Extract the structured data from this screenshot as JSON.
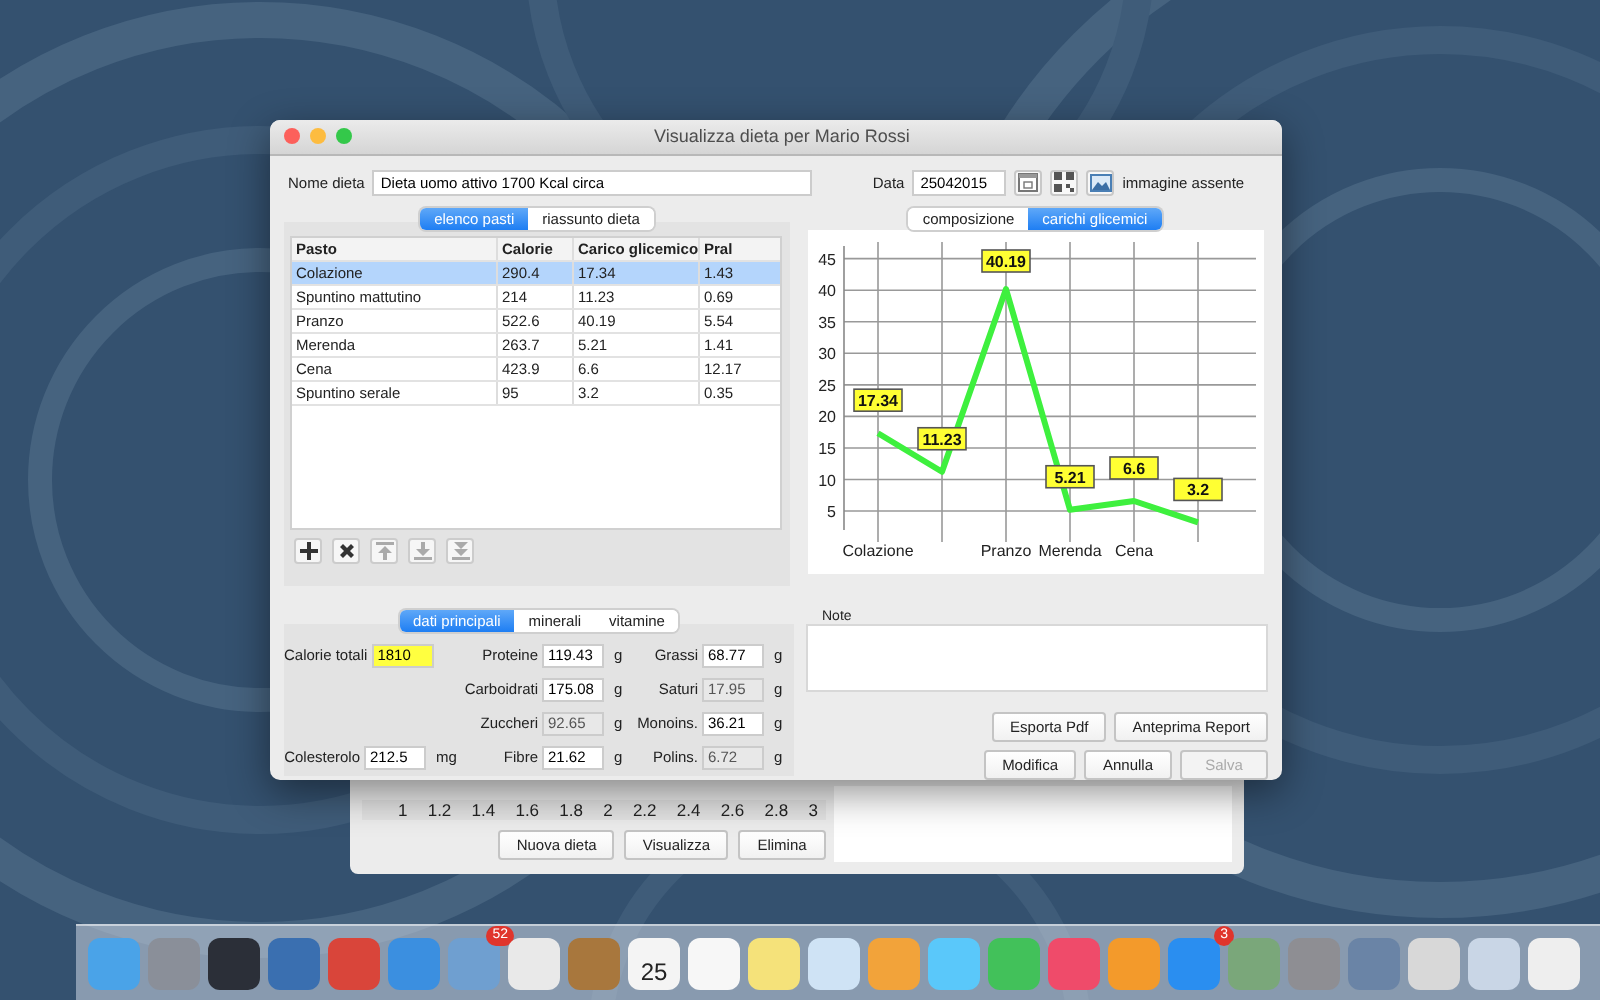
{
  "window": {
    "title": "Visualizza dieta per Mario Rossi",
    "diet_name": {
      "label": "Nome dieta",
      "value": "Dieta uomo attivo 1700 Kcal circa"
    },
    "date": {
      "label": "Data",
      "value": "25042015"
    },
    "image_status": "immagine assente",
    "meal_tabs": [
      {
        "label": "elenco pasti",
        "selected": true
      },
      {
        "label": "riassunto dieta",
        "selected": false
      }
    ],
    "table": {
      "columns": [
        "Pasto",
        "Calorie",
        "Carico glicemico",
        "Pral"
      ],
      "rows": [
        {
          "cells": [
            "Colazione",
            "290.4",
            "17.34",
            "1.43"
          ],
          "selected": true
        },
        {
          "cells": [
            "Spuntino mattutino",
            "214",
            "11.23",
            "0.69"
          ],
          "selected": false
        },
        {
          "cells": [
            "Pranzo",
            "522.6",
            "40.19",
            "5.54"
          ],
          "selected": false
        },
        {
          "cells": [
            "Merenda",
            "263.7",
            "5.21",
            "1.41"
          ],
          "selected": false
        },
        {
          "cells": [
            "Cena",
            "423.9",
            "6.6",
            "12.17"
          ],
          "selected": false
        },
        {
          "cells": [
            "Spuntino serale",
            "95",
            "3.2",
            "0.35"
          ],
          "selected": false
        }
      ]
    },
    "table_tools": [
      {
        "kind": "add",
        "disabled": false
      },
      {
        "kind": "remove",
        "disabled": false
      },
      {
        "kind": "top",
        "disabled": true
      },
      {
        "kind": "down",
        "disabled": true
      },
      {
        "kind": "bottom",
        "disabled": true
      }
    ],
    "chart_tabs": [
      {
        "label": "composizione",
        "selected": false
      },
      {
        "label": "carichi glicemici",
        "selected": true
      }
    ],
    "chart_data": {
      "type": "line",
      "categories": [
        "Colazione",
        null,
        "Pranzo",
        "Merenda",
        "Cena",
        null
      ],
      "series": [
        {
          "color": "#3ef03e",
          "values": [
            17.34,
            11.23,
            40.19,
            5.21,
            6.6,
            3.2
          ]
        }
      ],
      "yticks": [
        5,
        10,
        15,
        20,
        25,
        30,
        35,
        40,
        45
      ],
      "ylim": [
        2,
        47
      ],
      "grid": true,
      "data_labels": true
    },
    "nutrient_tabs": [
      {
        "label": "dati principali",
        "selected": true
      },
      {
        "label": "minerali",
        "selected": false
      },
      {
        "label": "vitamine",
        "selected": false
      }
    ],
    "nutrients": [
      [
        {
          "label": "Calorie totali",
          "value": "1810",
          "highlighted": true,
          "disabled": false
        },
        {
          "label": "Proteine",
          "value": "119.43",
          "unit": "g",
          "highlighted": false,
          "disabled": false
        },
        {
          "label": "Grassi",
          "value": "68.77",
          "unit": "g",
          "highlighted": false,
          "disabled": false
        }
      ],
      [
        {
          "label": "Carboidrati",
          "value": "175.08",
          "unit": "g",
          "highlighted": false,
          "disabled": false
        },
        {
          "label": "Saturi",
          "value": "17.95",
          "unit": "g",
          "highlighted": false,
          "disabled": true
        }
      ],
      [
        {
          "label": "Zuccheri",
          "value": "92.65",
          "unit": "g",
          "highlighted": false,
          "disabled": true
        },
        {
          "label": "Monoins.",
          "value": "36.21",
          "unit": "g",
          "highlighted": false,
          "disabled": false
        }
      ],
      [
        {
          "label": "Colesterolo",
          "value": "212.5",
          "unit": "mg",
          "highlighted": false,
          "disabled": false
        },
        {
          "label": "Fibre",
          "value": "21.62",
          "unit": "g",
          "highlighted": false,
          "disabled": false
        },
        {
          "label": "Polins.",
          "value": "6.72",
          "unit": "g",
          "highlighted": false,
          "disabled": true
        }
      ]
    ],
    "note": {
      "label": "Note"
    },
    "actions": [
      [
        {
          "label": "Esporta Pdf",
          "disabled": false
        },
        {
          "label": "Anteprima Report",
          "disabled": false
        }
      ],
      [
        {
          "label": "Modifica",
          "disabled": false
        },
        {
          "label": "Annulla",
          "disabled": false
        },
        {
          "label": "Salva",
          "disabled": true
        }
      ]
    ]
  },
  "background_window": {
    "scale": [
      "1",
      "1.2",
      "1.4",
      "1.6",
      "1.8",
      "2",
      "2.2",
      "2.4",
      "2.6",
      "2.8",
      "3"
    ],
    "buttons": [
      "Nuova dieta",
      "Visualizza",
      "Elimina"
    ]
  },
  "dock": {
    "items": [
      {
        "color": "#4aa3e8"
      },
      {
        "color": "#8a8f99"
      },
      {
        "color": "#2b2f38"
      },
      {
        "color": "#3a6fb0"
      },
      {
        "color": "#d9453a"
      },
      {
        "color": "#3b8fe0"
      },
      {
        "color": "#6f9fd0",
        "badge": "52"
      },
      {
        "color": "#e9e9e9"
      },
      {
        "color": "#a8773d"
      },
      {
        "color": "#f4f4f4",
        "label": "25"
      },
      {
        "color": "#f7f7f7"
      },
      {
        "color": "#f5e27a"
      },
      {
        "color": "#cfe3f5"
      },
      {
        "color": "#f2a33a"
      },
      {
        "color": "#5ac8fa"
      },
      {
        "color": "#42c15a"
      },
      {
        "color": "#ef4b6a"
      },
      {
        "color": "#f39a2b"
      },
      {
        "color": "#2a8ef0",
        "badge": "3"
      },
      {
        "color": "#7aa77a"
      },
      {
        "color": "#8e8e93"
      },
      {
        "color": "#6a84a6"
      },
      {
        "color": "#d8d8d8"
      },
      {
        "color": "#c9d6e6"
      },
      {
        "color": "#eeeeee"
      }
    ]
  }
}
